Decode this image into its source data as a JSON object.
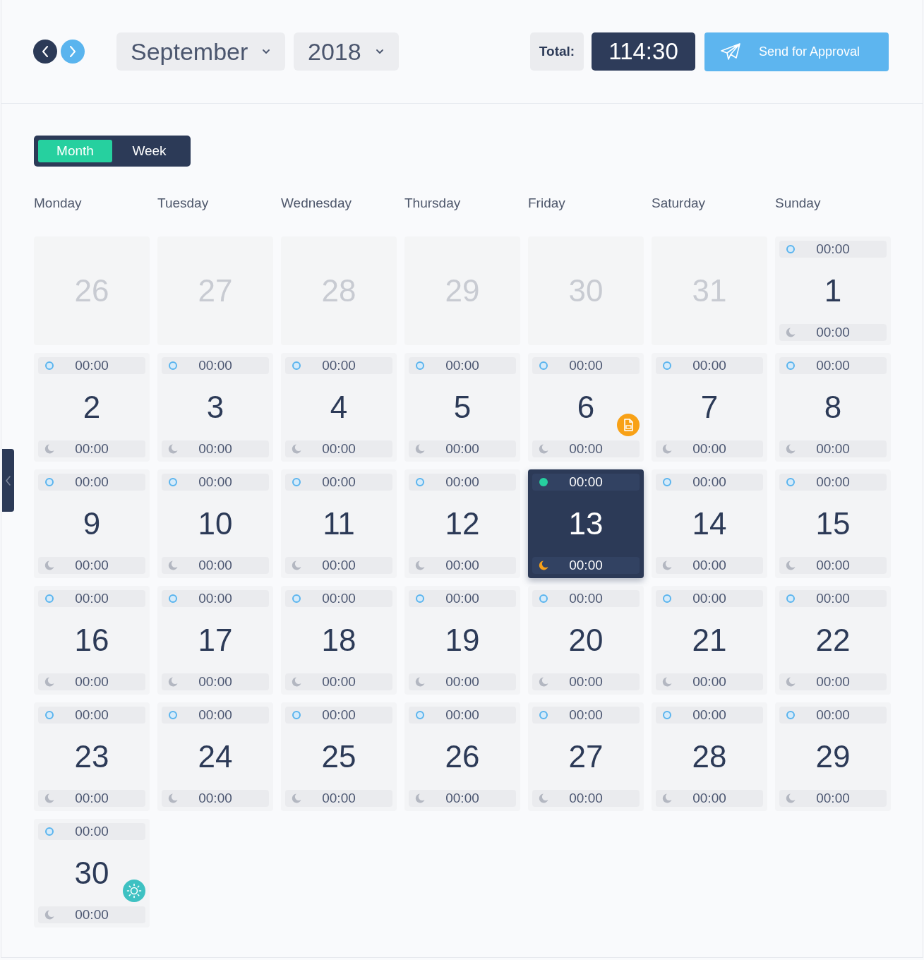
{
  "header": {
    "month": "September",
    "year": "2018",
    "total_label": "Total:",
    "total_value": "114:30",
    "send_button": "Send for Approval"
  },
  "view_toggle": [
    {
      "label": "Month",
      "selected": true
    },
    {
      "label": "Week",
      "selected": false
    }
  ],
  "weekdays": [
    "Monday",
    "Tuesday",
    "Wednesday",
    "Thursday",
    "Friday",
    "Saturday",
    "Sunday"
  ],
  "days": [
    {
      "day": "26",
      "in_month": false,
      "selected": false
    },
    {
      "day": "27",
      "in_month": false,
      "selected": false
    },
    {
      "day": "28",
      "in_month": false,
      "selected": false
    },
    {
      "day": "29",
      "in_month": false,
      "selected": false
    },
    {
      "day": "30",
      "in_month": false,
      "selected": false
    },
    {
      "day": "31",
      "in_month": false,
      "selected": false
    },
    {
      "day": "1",
      "in_month": true,
      "selected": false,
      "start": "00:00",
      "end": "00:00"
    },
    {
      "day": "2",
      "in_month": true,
      "selected": false,
      "start": "00:00",
      "end": "00:00"
    },
    {
      "day": "3",
      "in_month": true,
      "selected": false,
      "start": "00:00",
      "end": "00:00"
    },
    {
      "day": "4",
      "in_month": true,
      "selected": false,
      "start": "00:00",
      "end": "00:00"
    },
    {
      "day": "5",
      "in_month": true,
      "selected": false,
      "start": "00:00",
      "end": "00:00"
    },
    {
      "day": "6",
      "in_month": true,
      "selected": false,
      "start": "00:00",
      "end": "00:00",
      "badge": {
        "kind": "document"
      }
    },
    {
      "day": "7",
      "in_month": true,
      "selected": false,
      "start": "00:00",
      "end": "00:00"
    },
    {
      "day": "8",
      "in_month": true,
      "selected": false,
      "start": "00:00",
      "end": "00:00"
    },
    {
      "day": "9",
      "in_month": true,
      "selected": false,
      "start": "00:00",
      "end": "00:00"
    },
    {
      "day": "10",
      "in_month": true,
      "selected": false,
      "start": "00:00",
      "end": "00:00"
    },
    {
      "day": "11",
      "in_month": true,
      "selected": false,
      "start": "00:00",
      "end": "00:00"
    },
    {
      "day": "12",
      "in_month": true,
      "selected": false,
      "start": "00:00",
      "end": "00:00"
    },
    {
      "day": "13",
      "in_month": true,
      "selected": true,
      "start": "00:00",
      "end": "00:00"
    },
    {
      "day": "14",
      "in_month": true,
      "selected": false,
      "start": "00:00",
      "end": "00:00"
    },
    {
      "day": "15",
      "in_month": true,
      "selected": false,
      "start": "00:00",
      "end": "00:00"
    },
    {
      "day": "16",
      "in_month": true,
      "selected": false,
      "start": "00:00",
      "end": "00:00"
    },
    {
      "day": "17",
      "in_month": true,
      "selected": false,
      "start": "00:00",
      "end": "00:00"
    },
    {
      "day": "18",
      "in_month": true,
      "selected": false,
      "start": "00:00",
      "end": "00:00"
    },
    {
      "day": "19",
      "in_month": true,
      "selected": false,
      "start": "00:00",
      "end": "00:00"
    },
    {
      "day": "20",
      "in_month": true,
      "selected": false,
      "start": "00:00",
      "end": "00:00"
    },
    {
      "day": "21",
      "in_month": true,
      "selected": false,
      "start": "00:00",
      "end": "00:00"
    },
    {
      "day": "22",
      "in_month": true,
      "selected": false,
      "start": "00:00",
      "end": "00:00"
    },
    {
      "day": "23",
      "in_month": true,
      "selected": false,
      "start": "00:00",
      "end": "00:00"
    },
    {
      "day": "24",
      "in_month": true,
      "selected": false,
      "start": "00:00",
      "end": "00:00"
    },
    {
      "day": "25",
      "in_month": true,
      "selected": false,
      "start": "00:00",
      "end": "00:00"
    },
    {
      "day": "26",
      "in_month": true,
      "selected": false,
      "start": "00:00",
      "end": "00:00"
    },
    {
      "day": "27",
      "in_month": true,
      "selected": false,
      "start": "00:00",
      "end": "00:00"
    },
    {
      "day": "28",
      "in_month": true,
      "selected": false,
      "start": "00:00",
      "end": "00:00"
    },
    {
      "day": "29",
      "in_month": true,
      "selected": false,
      "start": "00:00",
      "end": "00:00"
    },
    {
      "day": "30",
      "in_month": true,
      "selected": false,
      "start": "00:00",
      "end": "00:00",
      "badge": {
        "kind": "sun"
      }
    }
  ]
}
